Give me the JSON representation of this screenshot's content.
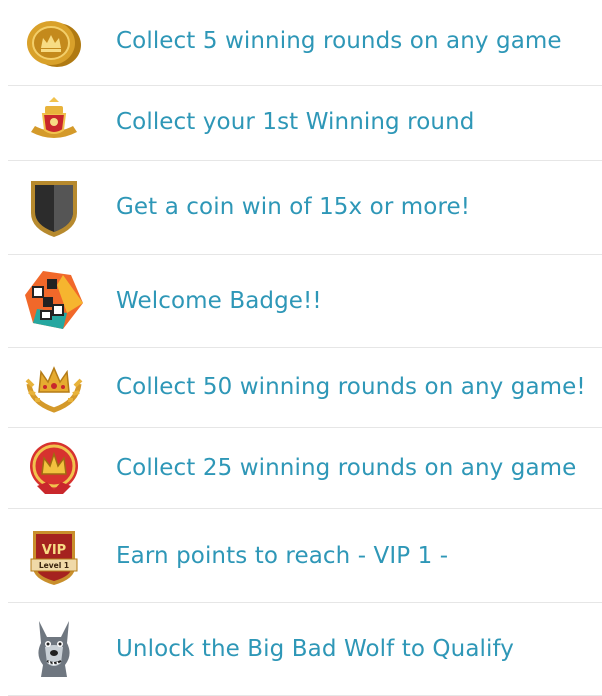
{
  "achievements": [
    {
      "label": "Collect 5 winning rounds on any game",
      "icon": "gold-coins-icon"
    },
    {
      "label": "Collect your 1st Winning round",
      "icon": "crest-trophy-icon"
    },
    {
      "label": "Get a coin win of 15x or more!",
      "icon": "shield-icon"
    },
    {
      "label": "Welcome Badge!!",
      "icon": "welcome-cubes-icon"
    },
    {
      "label": "Collect 50 winning rounds on any game!",
      "icon": "laurel-crown-icon"
    },
    {
      "label": "Collect 25 winning rounds on any game",
      "icon": "red-crown-emblem-icon"
    },
    {
      "label": "Earn points to reach - VIP 1 -",
      "icon": "vip-level-1-badge-icon",
      "badge_title": "VIP",
      "badge_sub": "Level 1"
    },
    {
      "label": "Unlock the Big Bad Wolf to Qualify",
      "icon": "big-bad-wolf-icon"
    }
  ],
  "colors": {
    "label": "#2e97b7",
    "divider": "#e6e6e6"
  }
}
